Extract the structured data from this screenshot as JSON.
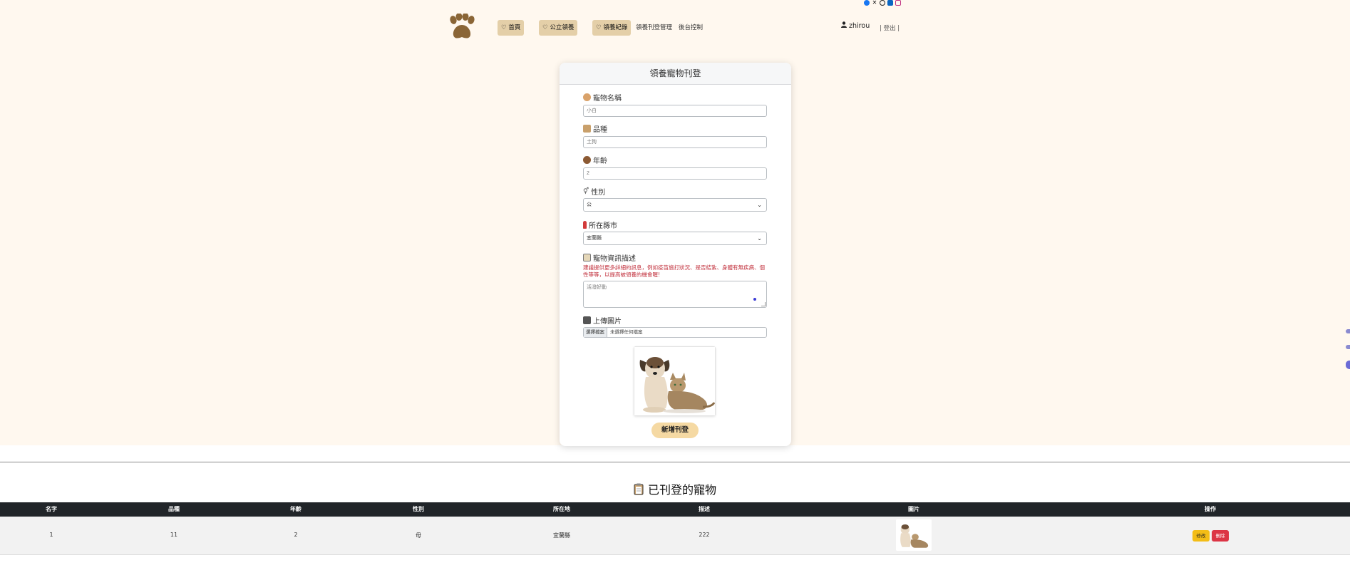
{
  "nav": {
    "home": "♡ 首頁",
    "public_adoption": "♡ 公立領養",
    "adoption_records": "♡ 領養紀錄",
    "listing_manage": "領養刊登管理",
    "admin_panel": "後台控制",
    "user": "zhirou",
    "logout": "| 登出 |"
  },
  "social_icons": [
    "facebook-icon",
    "x-icon",
    "threads-icon",
    "messenger-icon",
    "instagram-icon"
  ],
  "form": {
    "title": "領養寵物刊登",
    "name_label": "寵物名稱",
    "name_placeholder": "小白",
    "breed_label": "品種",
    "breed_placeholder": "土狗",
    "age_label": "年齡",
    "age_placeholder": "2",
    "gender_label": "性別",
    "gender_value": "公",
    "city_label": "所在縣市",
    "city_value": "宜蘭縣",
    "desc_label": "寵物資訊描述",
    "desc_hint": "建議提供更多詳細的訊息，例如疫苗施打狀況、是否結紮、身體有無疾病、個性等等，以提高被領養的機會喔!",
    "desc_placeholder": "活潑好動",
    "upload_label": "上傳圖片",
    "file_button": "選擇檔案",
    "file_status": "未選擇任何檔案",
    "submit_label": "新增刊登"
  },
  "listing": {
    "title": "已刊登的寵物",
    "columns": [
      "名字",
      "品種",
      "年齡",
      "性別",
      "所在地",
      "描述",
      "圖片",
      "操作"
    ],
    "rows": [
      {
        "name": "1",
        "breed": "11",
        "age": "2",
        "gender": "母",
        "location": "宜蘭縣",
        "description": "222",
        "edit_label": "修改",
        "delete_label": "刪除"
      }
    ]
  },
  "colors": {
    "page_bg": "#fff8ef",
    "nav_button": "#e4cfa8",
    "submit": "#f5d9a3",
    "table_header": "#212529",
    "edit": "#f3bd17",
    "delete": "#dc3545",
    "hint": "#c2313d",
    "paw": "#8a6536"
  }
}
